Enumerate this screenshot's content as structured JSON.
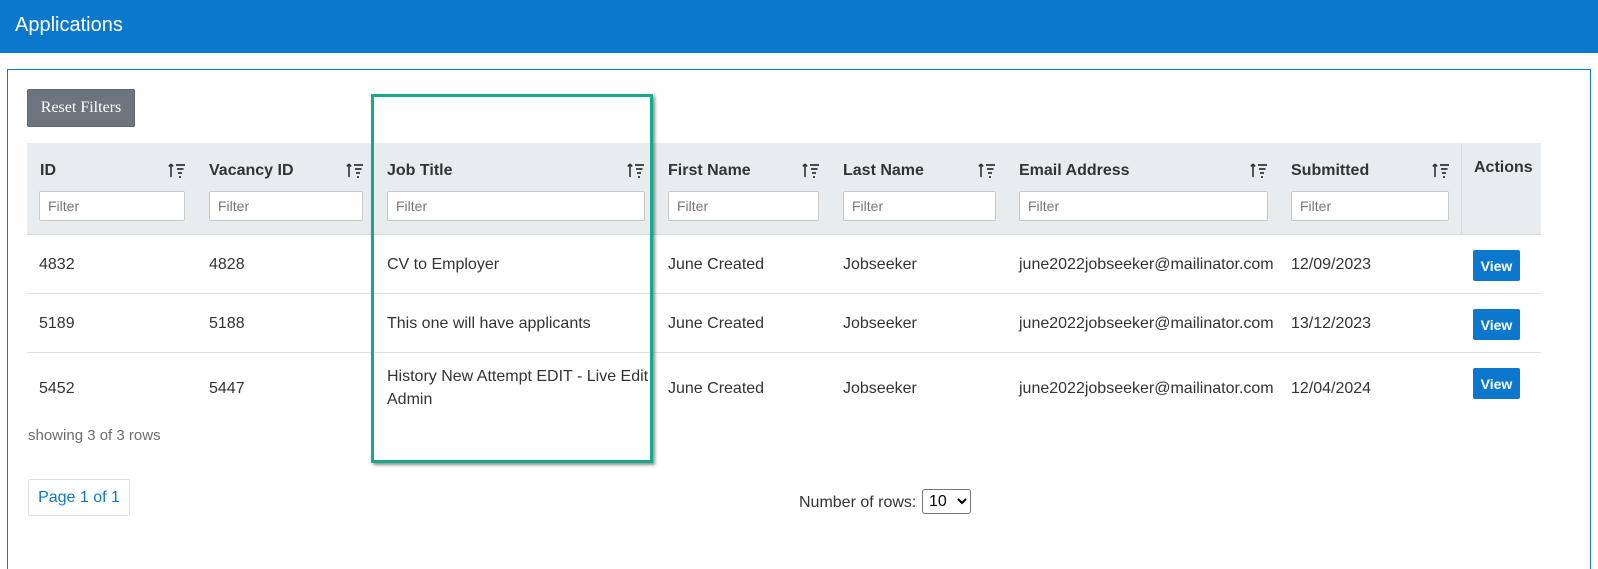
{
  "header": {
    "title": "Applications"
  },
  "toolbar": {
    "reset_label": "Reset Filters"
  },
  "table": {
    "columns": [
      {
        "key": "id",
        "label": "ID",
        "filter_placeholder": "Filter"
      },
      {
        "key": "vacancy_id",
        "label": "Vacancy ID",
        "filter_placeholder": "Filter"
      },
      {
        "key": "job_title",
        "label": "Job Title",
        "filter_placeholder": "Filter"
      },
      {
        "key": "first_name",
        "label": "First Name",
        "filter_placeholder": "Filter"
      },
      {
        "key": "last_name",
        "label": "Last Name",
        "filter_placeholder": "Filter"
      },
      {
        "key": "email",
        "label": "Email Address",
        "filter_placeholder": "Filter"
      },
      {
        "key": "submitted",
        "label": "Submitted",
        "filter_placeholder": "Filter"
      },
      {
        "key": "actions",
        "label": "Actions"
      }
    ],
    "rows": [
      {
        "id": "4832",
        "vacancy_id": "4828",
        "job_title": "CV to Employer",
        "first_name": "June Created",
        "last_name": "Jobseeker",
        "email": "june2022jobseeker@mailinator.com",
        "submitted": "12/09/2023",
        "action": "View"
      },
      {
        "id": "5189",
        "vacancy_id": "5188",
        "job_title": "This one will have applicants",
        "first_name": "June Created",
        "last_name": "Jobseeker",
        "email": "june2022jobseeker@mailinator.com",
        "submitted": "13/12/2023",
        "action": "View"
      },
      {
        "id": "5452",
        "vacancy_id": "5447",
        "job_title": "History New Attempt EDIT - Live Edit Admin",
        "first_name": "June Created",
        "last_name": "Jobseeker",
        "email": "june2022jobseeker@mailinator.com",
        "submitted": "12/04/2024",
        "action": "View"
      }
    ]
  },
  "footer": {
    "status": "showing 3 of 3 rows",
    "page": "Page 1 of 1",
    "rows_label": "Number of rows:",
    "rows_value": "10"
  },
  "colors": {
    "brand": "#0c78cd",
    "highlight": "#16a98b",
    "header_bg": "#e9ecef",
    "button_gray": "#6c757d"
  }
}
